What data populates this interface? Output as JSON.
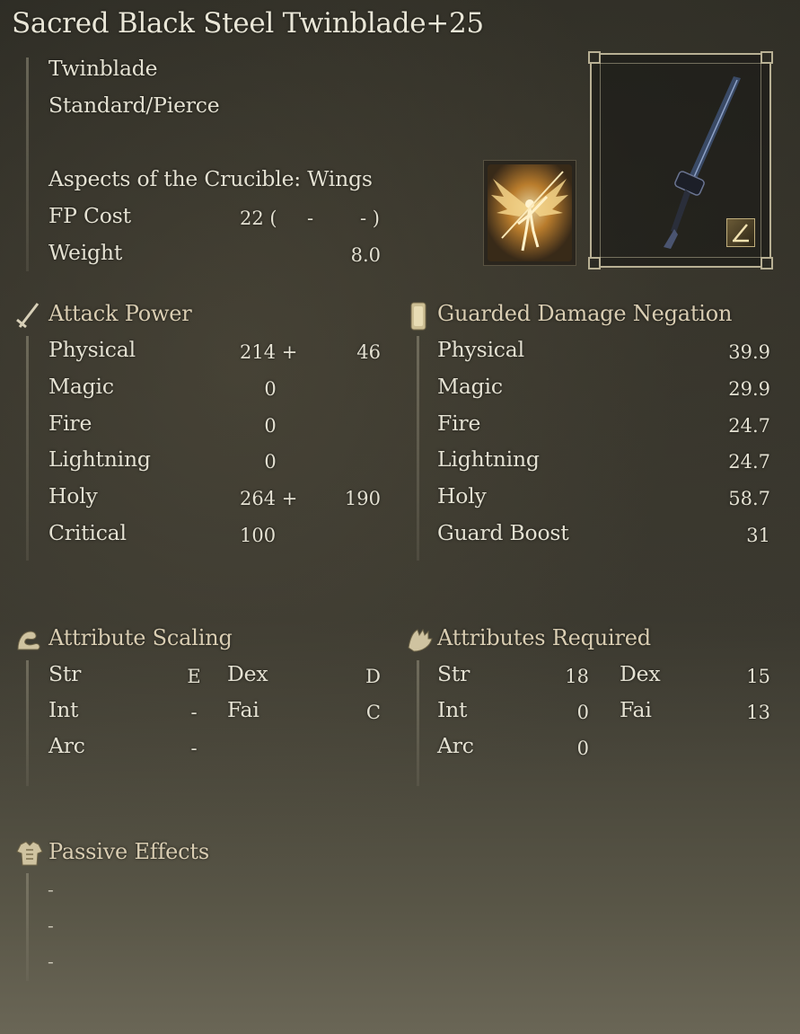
{
  "title": "Sacred Black Steel Twinblade+25",
  "weapon": {
    "type": "Twinblade",
    "damage_type": "Standard/Pierce",
    "skill": "Aspects of the Crucible: Wings",
    "fp_label": "FP Cost",
    "fp_value": "22 (",
    "fp_dash1": "-",
    "fp_dash2": "- )",
    "weight_label": "Weight",
    "weight_value": "8.0"
  },
  "icons": {
    "attack": "sword-icon",
    "guard": "shield-icon",
    "scaling": "flexed-arm-icon",
    "required": "hand-icon",
    "passive": "armor-icon",
    "affinity": "weapon-affinity-icon",
    "skill": "winged-figure-icon"
  },
  "attack_power": {
    "heading": "Attack Power",
    "rows": [
      {
        "label": "Physical",
        "base": "214 +",
        "bonus": "46"
      },
      {
        "label": "Magic",
        "base": "0",
        "bonus": ""
      },
      {
        "label": "Fire",
        "base": "0",
        "bonus": ""
      },
      {
        "label": "Lightning",
        "base": "0",
        "bonus": ""
      },
      {
        "label": "Holy",
        "base": "264 +",
        "bonus": "190"
      },
      {
        "label": "Critical",
        "base": "100",
        "bonus": ""
      }
    ]
  },
  "guarded": {
    "heading": "Guarded Damage Negation",
    "rows": [
      {
        "label": "Physical",
        "value": "39.9"
      },
      {
        "label": "Magic",
        "value": "29.9"
      },
      {
        "label": "Fire",
        "value": "24.7"
      },
      {
        "label": "Lightning",
        "value": "24.7"
      },
      {
        "label": "Holy",
        "value": "58.7"
      },
      {
        "label": "Guard Boost",
        "value": "31"
      }
    ]
  },
  "scaling": {
    "heading": "Attribute Scaling",
    "str_label": "Str",
    "str": "E",
    "dex_label": "Dex",
    "dex": "D",
    "int_label": "Int",
    "int": "-",
    "fai_label": "Fai",
    "fai": "C",
    "arc_label": "Arc",
    "arc": "-"
  },
  "required": {
    "heading": "Attributes Required",
    "str_label": "Str",
    "str": "18",
    "dex_label": "Dex",
    "dex": "15",
    "int_label": "Int",
    "int": "0",
    "fai_label": "Fai",
    "fai": "13",
    "arc_label": "Arc",
    "arc": "0"
  },
  "passive": {
    "heading": "Passive Effects",
    "items": [
      "-",
      "-",
      "-"
    ]
  },
  "colors": {
    "heading": "#d9cdb2",
    "text": "#e4e1d2",
    "frame": "#b8b094"
  }
}
